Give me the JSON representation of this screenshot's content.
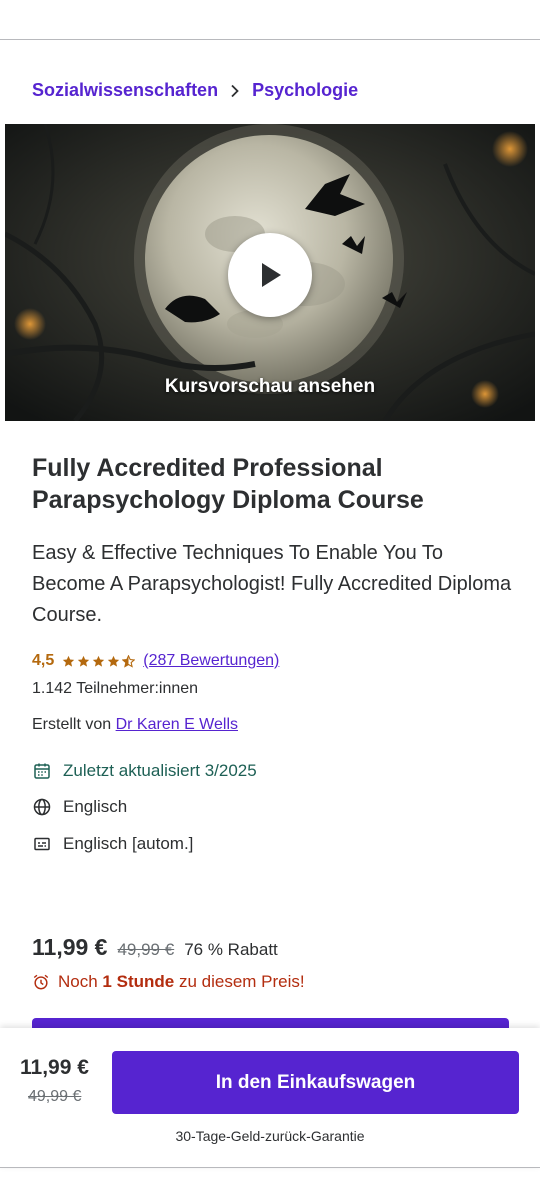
{
  "breadcrumb": {
    "category": "Sozialwissenschaften",
    "subcategory": "Psychologie"
  },
  "preview": {
    "label": "Kursvorschau ansehen"
  },
  "course": {
    "title": "Fully Accredited Professional Parapsychology Diploma Course",
    "subtitle": "Easy & Effective Techniques To Enable You To Become A Parapsychologist! Fully Accredited Diploma Course.",
    "rating": "4,5",
    "rating_value": 4.5,
    "rating_max": 5,
    "reviews": "(287 Bewertungen)",
    "students": "1.142 Teilnehmer:innen",
    "created_by_label": "Erstellt von",
    "instructor": "Dr Karen E Wells",
    "last_updated": "Zuletzt aktualisiert 3/2025",
    "language": "Englisch",
    "captions": "Englisch [autom.]"
  },
  "pricing": {
    "current": "11,99 €",
    "original": "49,99 €",
    "discount": "76 % Rabatt",
    "urgency_prefix": "Noch",
    "urgency_time": "1 Stunde",
    "urgency_suffix": "zu diesem Preis!"
  },
  "sticky": {
    "current": "11,99 €",
    "original": "49,99 €",
    "cart_button": "In den Einkaufswagen",
    "guarantee": "30-Tage-Geld-zurück-Garantie"
  },
  "colors": {
    "brand": "#5624d0",
    "rating": "#b4690e",
    "updated": "#1e6055",
    "urgency": "#b32d0f"
  },
  "icons": {
    "breadcrumb_separator": "chevron-right-icon",
    "play": "play-icon",
    "updated": "calendar-icon",
    "language": "globe-icon",
    "captions": "closed-captions-icon",
    "urgency": "alarm-clock-icon"
  }
}
